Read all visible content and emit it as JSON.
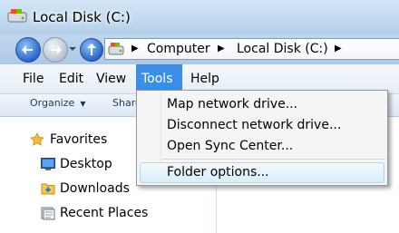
{
  "window": {
    "title": "Local Disk (C:)"
  },
  "address_bar": {
    "crumbs": [
      "Computer",
      "Local Disk (C:)"
    ]
  },
  "menubar": {
    "items": [
      "File",
      "Edit",
      "View",
      "Tools",
      "Help"
    ],
    "active": "Tools"
  },
  "toolbar": {
    "organize_label": "Organize",
    "share_label": "Share"
  },
  "navigation": {
    "favorites_label": "Favorites",
    "items": [
      "Desktop",
      "Downloads",
      "Recent Places"
    ]
  },
  "tools_menu": {
    "items": [
      "Map network drive...",
      "Disconnect network drive...",
      "Open Sync Center...",
      "Folder options..."
    ],
    "highlighted": "Folder options..."
  },
  "content": {
    "fragment": ""
  },
  "colors": {
    "menu_active": "#3a8ee6",
    "title_bar": "#c6dcf1",
    "hover_border": "#a8d8f6"
  }
}
